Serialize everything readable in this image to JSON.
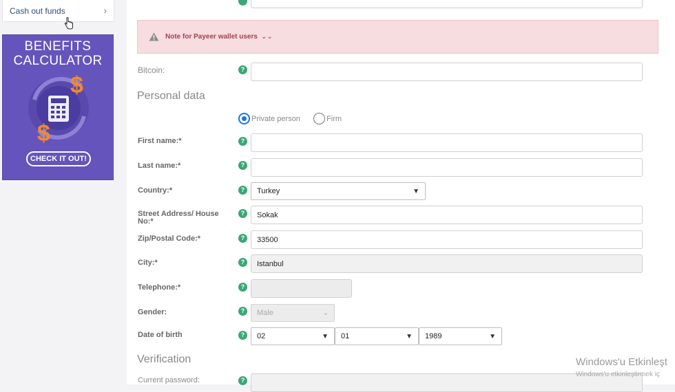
{
  "sidebar": {
    "cash_out_label": "Cash out funds",
    "chevron": "›"
  },
  "banner": {
    "title_line1": "BENEFITS",
    "title_line2": "CALCULATOR",
    "cta": "CHECK IT OUT!",
    "bg_color": "#6654bd"
  },
  "notice": {
    "text": "Note for Payeer wallet users",
    "chevron": "⌄⌄"
  },
  "fields": {
    "bitcoin_label": "Bitcoin:",
    "personal_section": "Personal data",
    "private_person": "Private person",
    "firm": "Firm",
    "first_name_label": "First name:*",
    "last_name_label": "Last name:*",
    "country_label": "Country:*",
    "country_value": "Turkey",
    "street_label": "Street Address/ House No:*",
    "street_value": "Sokak",
    "zip_label": "Zip/Postal Code:*",
    "zip_value": "33500",
    "city_label": "City:*",
    "city_value": "Istanbul",
    "telephone_label": "Telephone:*",
    "gender_label": "Gender:",
    "gender_value": "Male",
    "dob_label": "Date of birth",
    "dob_day": "02",
    "dob_month": "01",
    "dob_year": "1989",
    "verification_section": "Verification",
    "current_password_label": "Current password:"
  },
  "help_glyph": "?",
  "watermark": {
    "line1": "Windows'u Etkinleşt",
    "line2": "Windows'u etkinleştirmek iç"
  },
  "colors": {
    "help_green": "#3aa776",
    "notice_bg": "#f7dce0",
    "notice_text": "#a4404e",
    "radio_blue": "#1a73e8"
  }
}
